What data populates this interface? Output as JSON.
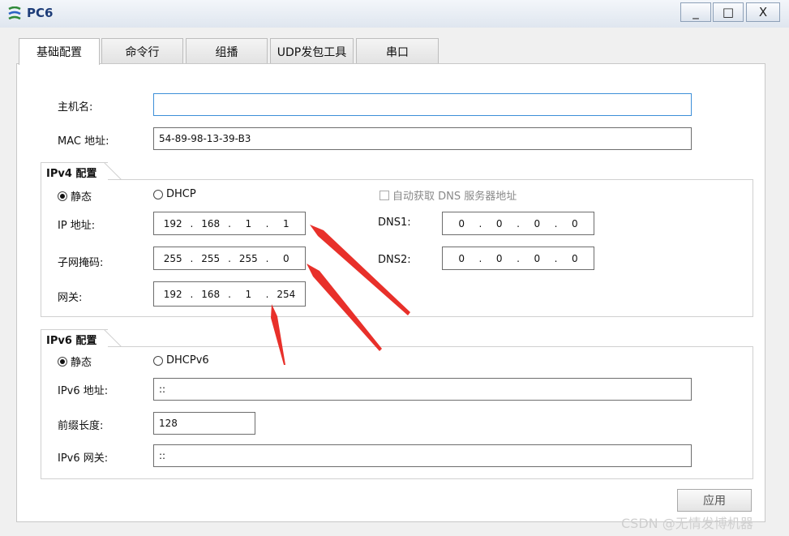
{
  "window": {
    "title": "PC6",
    "minimize": "_",
    "maximize": "□",
    "close": "X"
  },
  "tabs": [
    {
      "label": "基础配置"
    },
    {
      "label": "命令行"
    },
    {
      "label": "组播"
    },
    {
      "label": "UDP发包工具"
    },
    {
      "label": "串口"
    }
  ],
  "basic": {
    "hostname_label": "主机名:",
    "hostname_value": "",
    "mac_label": "MAC 地址:",
    "mac_value": "54-89-98-13-39-B3"
  },
  "ipv4": {
    "group_title": "IPv4 配置",
    "static_label": "静态",
    "dhcp_label": "DHCP",
    "auto_dns_label": "自动获取 DNS 服务器地址",
    "ip_label": "IP 地址:",
    "ip": [
      "192",
      "168",
      "1",
      "1"
    ],
    "mask_label": "子网掩码:",
    "mask": [
      "255",
      "255",
      "255",
      "0"
    ],
    "gateway_label": "网关:",
    "gateway": [
      "192",
      "168",
      "1",
      "254"
    ],
    "dns1_label": "DNS1:",
    "dns1": [
      "0",
      "0",
      "0",
      "0"
    ],
    "dns2_label": "DNS2:",
    "dns2": [
      "0",
      "0",
      "0",
      "0"
    ],
    "dot": "."
  },
  "ipv6": {
    "group_title": "IPv6 配置",
    "static_label": "静态",
    "dhcp_label": "DHCPv6",
    "addr_label": "IPv6 地址:",
    "addr_value": "::",
    "prefix_label": "前缀长度:",
    "prefix_value": "128",
    "gateway_label": "IPv6 网关:",
    "gateway_value": "::"
  },
  "apply_label": "应用",
  "watermark": "CSDN @无情发博机器",
  "colors": {
    "arrow": "#e8302a",
    "focus": "#3d8fd8",
    "title": "#1d3c78"
  }
}
